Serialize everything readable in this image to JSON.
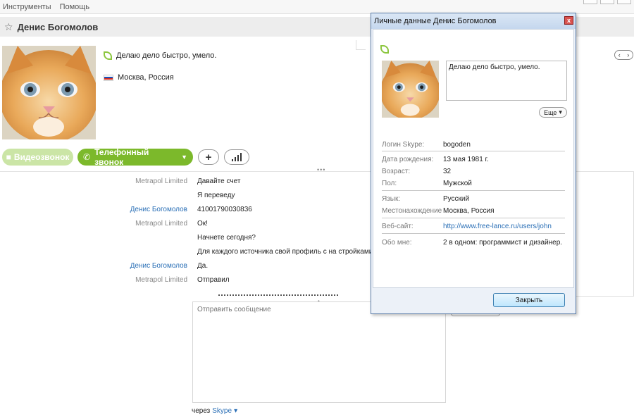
{
  "menu": {
    "items": [
      "Инструменты",
      "Помощь"
    ]
  },
  "contact": {
    "name": "Денис Богомолов",
    "mood": "Делаю дело быстро, умело.",
    "location": "Москва, Россия"
  },
  "call": {
    "video_label": "Видеозвонок",
    "phone_label": "Телефонный звонок",
    "add_label": "+",
    "signal_label": "signal"
  },
  "chat": {
    "messages": [
      {
        "sender": "Metrapol Limited",
        "sender_color": "gray",
        "text": "Давайте счет"
      },
      {
        "sender": "",
        "sender_color": "gray",
        "text": "Я переведу"
      },
      {
        "sender": "Денис Богомолов",
        "sender_color": "blue",
        "text": "41001790030836"
      },
      {
        "sender": "Metrapol Limited",
        "sender_color": "gray",
        "text": "Ок!"
      },
      {
        "sender": "",
        "sender_color": "gray",
        "text": "Начнете сегодня?"
      },
      {
        "sender": "",
        "sender_color": "gray",
        "text": "Для каждого источника свой профиль с на стройками"
      },
      {
        "sender": "Денис Богомолов",
        "sender_color": "blue",
        "text": "Да."
      },
      {
        "sender": "Metrapol Limited",
        "sender_color": "gray",
        "text": "Отправил"
      }
    ],
    "input_placeholder": "Отправить сообщение",
    "via_label": "через",
    "via_service": "Skype"
  },
  "dialog": {
    "title": "Личные данные Денис Богомолов",
    "close_x": "x",
    "mood": "Делаю дело быстро, умело.",
    "more_label": "Еще",
    "fields": [
      {
        "label": "Логин Skype:",
        "value": "bogoden"
      },
      {
        "label": "Дата рождения:",
        "value": "13 мая 1981 г."
      },
      {
        "label": "Возраст:",
        "value": "32"
      },
      {
        "label": "Пол:",
        "value": "Мужской"
      },
      {
        "label": "Язык:",
        "value": "Русский"
      },
      {
        "label": "Местонахождение",
        "value": "Москва, Россия"
      },
      {
        "label": "Веб-сайт:",
        "value": "http://www.free-lance.ru/users/john"
      },
      {
        "label": "Обо мне:",
        "value": "2 в одном: программист и дизайнер."
      }
    ],
    "close_button": "Закрыть"
  },
  "colors": {
    "accent_green": "#7cb92b",
    "link_blue": "#2a6fb6"
  }
}
